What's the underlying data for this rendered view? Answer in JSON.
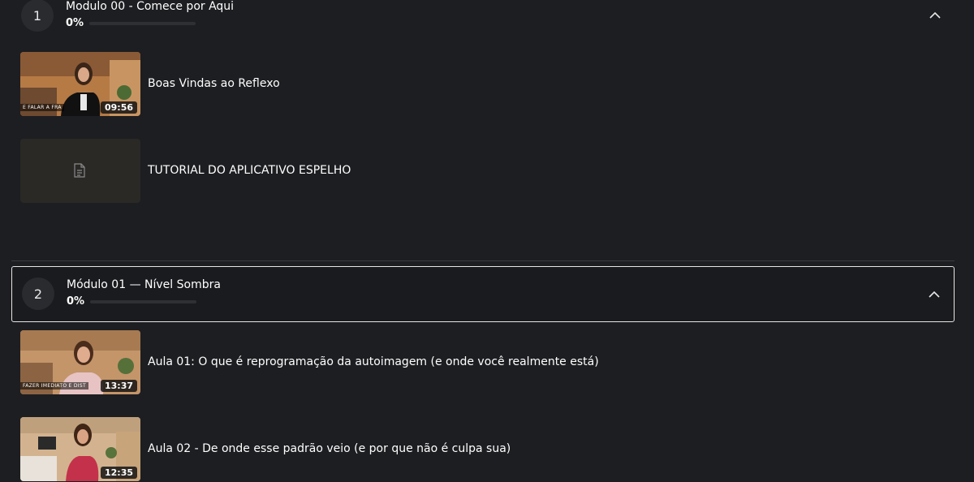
{
  "modules": [
    {
      "number": "1",
      "title": "Modulo 00 - Comece por Aqui",
      "progress_label": "0%",
      "progress": 0,
      "lessons": [
        {
          "title": "Boas Vindas ao Reflexo",
          "duration": "09:56",
          "caption": "E FALAR A FRA"
        },
        {
          "title": "TUTORIAL DO APLICATIVO ESPELHO",
          "icon": "document-icon"
        }
      ]
    },
    {
      "number": "2",
      "title": "Módulo 01 — Nível Sombra",
      "progress_label": "0%",
      "progress": 0,
      "lessons": [
        {
          "title": "Aula 01: O que é reprogramação da autoimagem (e onde você realmente está)",
          "duration": "13:37",
          "caption": "FAZER IMEDIATO E DIST"
        },
        {
          "title": "Aula 02 - De onde esse padrão veio (e por que não é culpa sua)",
          "duration": "12:35"
        }
      ]
    }
  ]
}
